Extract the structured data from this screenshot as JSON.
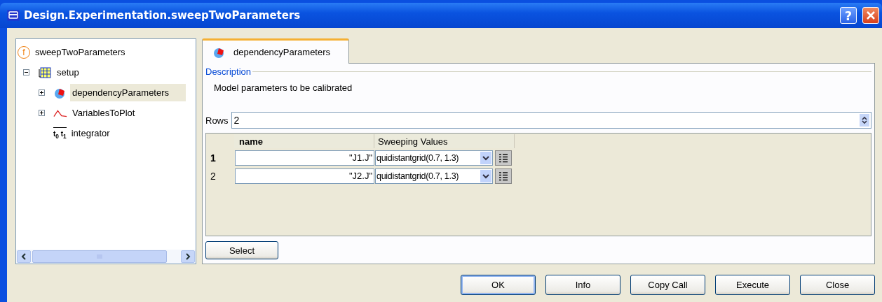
{
  "window": {
    "title": "Design.Experimentation.sweepTwoParameters",
    "help": "?"
  },
  "tree": {
    "root": {
      "label": "sweepTwoParameters",
      "glyph": "f",
      "kind": "function",
      "selected": false,
      "children": [
        {
          "label": "setup",
          "kind": "record",
          "expanded": true,
          "selected": false,
          "children": [
            {
              "label": "dependencyParameters",
              "kind": "parameters",
              "expanded": false,
              "selected": true
            },
            {
              "label": "VariablesToPlot",
              "kind": "plot",
              "expanded": false,
              "selected": false
            },
            {
              "label": "integrator",
              "kind": "integrator",
              "glyph": "t$_{0}$ t$_{1}$",
              "selected": false
            }
          ]
        }
      ]
    }
  },
  "tabs": [
    {
      "label": "dependencyParameters",
      "selected": true
    }
  ],
  "description": {
    "legend": "Description",
    "text": "Model parameters to be calibrated"
  },
  "rows_field": {
    "label": "Rows",
    "value": "2"
  },
  "table": {
    "columns": [
      {
        "label": "name",
        "bold": true
      },
      {
        "label": "Sweeping Values",
        "bold": false
      }
    ],
    "rows": [
      {
        "index": "1",
        "current": true,
        "name": "\"J1.J\"",
        "value": "quidistantgrid(0.7, 1.3)"
      },
      {
        "index": "2",
        "current": false,
        "name": "\"J2.J\"",
        "value": "quidistantgrid(0.7, 1.3)"
      }
    ]
  },
  "select_button": "Select",
  "buttons": [
    {
      "label": "OK",
      "default": true
    },
    {
      "label": "Info",
      "default": false
    },
    {
      "label": "Copy Call",
      "default": false
    },
    {
      "label": "Execute",
      "default": false
    },
    {
      "label": "Close",
      "default": false
    }
  ]
}
